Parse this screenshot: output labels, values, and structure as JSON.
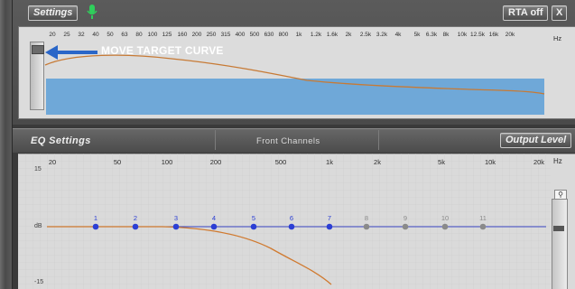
{
  "top_bar": {
    "settings_label": "Settings",
    "rta_label": "RTA off",
    "close_label": "X",
    "mic_icon": "microphone-icon"
  },
  "rta": {
    "hz_unit": "Hz",
    "ticks": [
      "20",
      "25",
      "32",
      "40",
      "50",
      "63",
      "80",
      "100",
      "125",
      "160",
      "200",
      "250",
      "315",
      "400",
      "500",
      "630",
      "800",
      "1k",
      "1.2k",
      "1.6k",
      "2k",
      "2.5k",
      "3.2k",
      "4k",
      "5k",
      "6.3k",
      "8k",
      "10k",
      "12.5k",
      "16k",
      "20k"
    ],
    "target_label": "MOVE TARGET CURVE",
    "arrow_icon": "left-arrow-icon"
  },
  "eq": {
    "title": "EQ Settings",
    "channel": "Front Channels",
    "output_level_label": "Output Level",
    "hz_unit": "Hz",
    "freq_ticks": [
      "20",
      "50",
      "100",
      "200",
      "500",
      "1k",
      "2k",
      "5k",
      "10k",
      "20k"
    ],
    "db_top": "15",
    "db_mid": "dB",
    "db_bottom": "-15",
    "bands": [
      {
        "num": "1",
        "active": true
      },
      {
        "num": "2",
        "active": true
      },
      {
        "num": "3",
        "active": true
      },
      {
        "num": "4",
        "active": true
      },
      {
        "num": "5",
        "active": true
      },
      {
        "num": "6",
        "active": true
      },
      {
        "num": "7",
        "active": true
      },
      {
        "num": "8",
        "active": false
      },
      {
        "num": "9",
        "active": false
      },
      {
        "num": "10",
        "active": false
      },
      {
        "num": "11",
        "active": false
      }
    ],
    "colors": {
      "active_band": "#2c3fd4",
      "inactive_band": "#8a8a8a",
      "curve": "#d07a30",
      "line": "#3a47c4"
    }
  }
}
